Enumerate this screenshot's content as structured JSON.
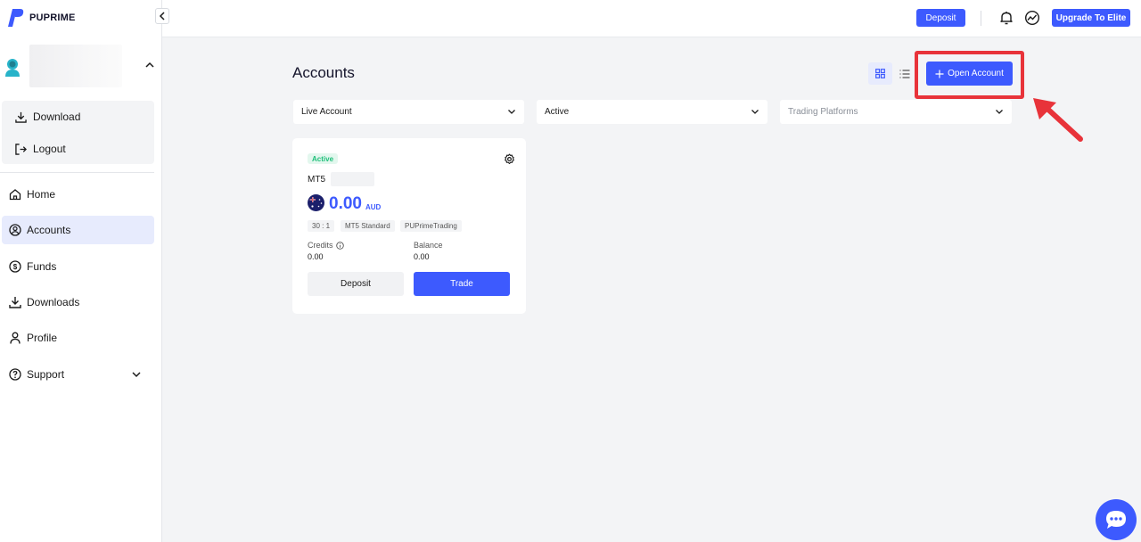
{
  "brand": {
    "name": "PUPRIME",
    "color": "#3d5afe",
    "highlight_color": "#e8333a"
  },
  "sidebar": {
    "collapse_icon": "chevron-left-icon",
    "user": {
      "avatar": "user-avatar-icon",
      "expand_icon": "chevron-up-icon"
    },
    "menu": [
      {
        "label": "Download",
        "icon": "download-icon"
      },
      {
        "label": "Logout",
        "icon": "logout-icon"
      }
    ],
    "nav": [
      {
        "label": "Home",
        "icon": "home-icon",
        "active": false
      },
      {
        "label": "Accounts",
        "icon": "user-circle-icon",
        "active": true
      },
      {
        "label": "Funds",
        "icon": "dollar-circle-icon",
        "active": false
      },
      {
        "label": "Downloads",
        "icon": "download-icon",
        "active": false
      },
      {
        "label": "Profile",
        "icon": "person-icon",
        "active": false
      },
      {
        "label": "Support",
        "icon": "help-circle-icon",
        "active": false
      }
    ]
  },
  "header": {
    "deposit_label": "Deposit",
    "upgrade_label": "Upgrade To Elite",
    "icons": [
      "bell-icon",
      "speedometer-icon"
    ]
  },
  "main": {
    "title": "Accounts",
    "view_toggle": [
      "grid-view-icon",
      "list-view-icon"
    ],
    "open_account_label": "Open Account",
    "filters": {
      "account_type": "Live Account",
      "status": "Active",
      "platform_placeholder": "Trading Platforms"
    },
    "card": {
      "status": "Active",
      "platform": "MT5",
      "balance": "0.00",
      "currency": "AUD",
      "tags": [
        "30 : 1",
        "MT5 Standard",
        "PUPrimeTrading"
      ],
      "credits_label": "Credits",
      "credits_value": "0.00",
      "balance_label": "Balance",
      "balance_value": "0.00",
      "deposit_label": "Deposit",
      "trade_label": "Trade"
    }
  },
  "chat_icon": "chat-bubble-icon"
}
